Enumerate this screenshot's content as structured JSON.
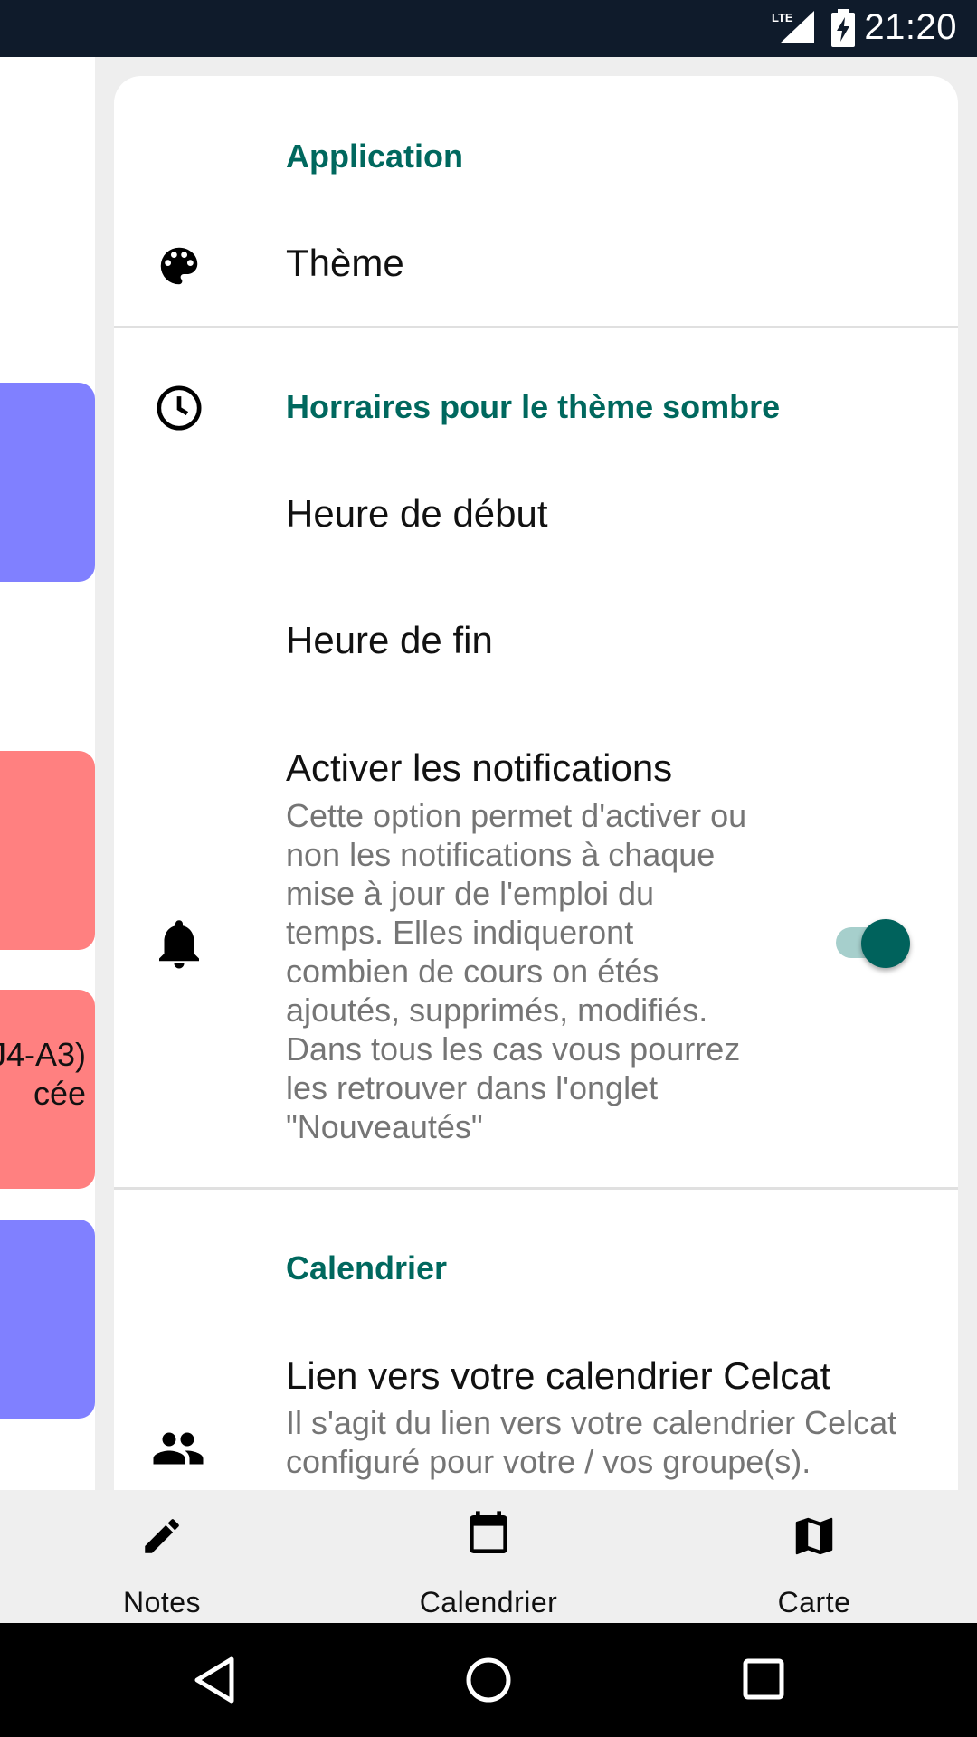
{
  "status_bar": {
    "time": "21:20",
    "network": "LTE",
    "battery_icon": "battery-charging-icon"
  },
  "background_events": [
    {
      "color": "#8080ff",
      "text_lines": []
    },
    {
      "color": "#ff8080",
      "text_lines": []
    },
    {
      "color": "#ff8080",
      "text_lines": [
        "J4-A3)",
        "cée"
      ]
    },
    {
      "color": "#8080ff",
      "text_lines": []
    }
  ],
  "settings": {
    "application_header": "Application",
    "theme_title": "Thème",
    "dark_schedule_header": "Horraires pour le thème sombre",
    "start_time_title": "Heure de début",
    "end_time_title": "Heure de fin",
    "notifications_title": "Activer les notifications",
    "notifications_summary": "Cette option permet d'activer ou non les notifications à chaque mise à jour de l'emploi du temps. Elles indiqueront combien de cours on étés ajoutés, supprimés, modifiés. Dans tous les cas vous pourrez les retrouver dans l'onglet \"Nouveautés\"",
    "notifications_enabled": true,
    "calendar_header": "Calendrier",
    "celcat_title": "Lien vers votre calendrier Celcat",
    "celcat_summary": "Il s'agit du lien vers votre calendrier Celcat configuré pour votre / vos groupe(s)."
  },
  "bottom_nav": [
    {
      "label": "Notes",
      "icon": "pencil-icon"
    },
    {
      "label": "Calendrier",
      "icon": "calendar-icon"
    },
    {
      "label": "Carte",
      "icon": "map-icon"
    }
  ],
  "colors": {
    "accent": "#00685e",
    "toggle_thumb": "#00625c",
    "toggle_track": "#a6cfcc"
  }
}
